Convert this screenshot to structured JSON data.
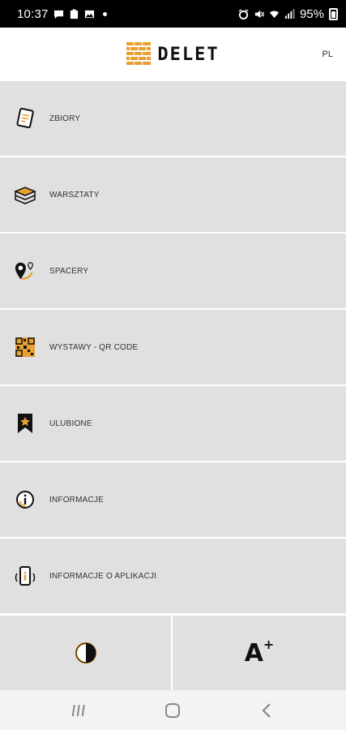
{
  "status_bar": {
    "time": "10:37",
    "battery": "95%",
    "left_icons": [
      "message-icon",
      "clipboard-icon",
      "image-icon",
      "dot-icon"
    ],
    "right_icons": [
      "alarm-icon",
      "mute-icon",
      "wifi-icon",
      "signal-icon",
      "battery-icon"
    ]
  },
  "header": {
    "logo_text": "DELET",
    "language": "PL"
  },
  "menu": {
    "items": [
      {
        "label": "ZBIORY",
        "icon": "collection-icon"
      },
      {
        "label": "WARSZTATY",
        "icon": "books-stack-icon"
      },
      {
        "label": "SPACERY",
        "icon": "map-pin-icon"
      },
      {
        "label": "WYSTAWY - QR CODE",
        "icon": "qr-code-icon"
      },
      {
        "label": "ULUBIONE",
        "icon": "bookmark-star-icon"
      },
      {
        "label": "INFORMACJE",
        "icon": "info-icon"
      },
      {
        "label": "INFORMACJE O APLIKACJI",
        "icon": "app-info-icon"
      }
    ]
  },
  "tools": {
    "contrast_icon": "contrast-icon",
    "font_size_label": "A",
    "font_size_suffix": "+"
  },
  "nav": {
    "icons": [
      "recent-apps-icon",
      "home-icon",
      "back-icon"
    ]
  },
  "colors": {
    "accent": "#e8a030",
    "menu_bg": "#e0e0e0",
    "status_bg": "#000000"
  }
}
